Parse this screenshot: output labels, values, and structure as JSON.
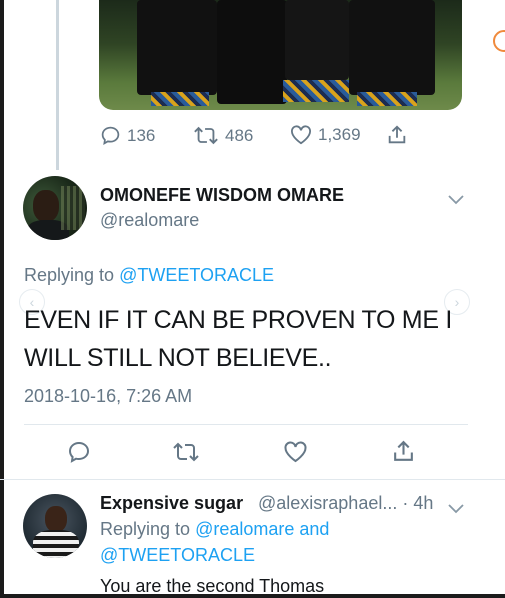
{
  "top_tweet": {
    "metrics": {
      "replies": "136",
      "retweets": "486",
      "likes": "1,369"
    }
  },
  "main_tweet": {
    "display_name": "OMONEFE WISDOM OMARE",
    "handle": "@realomare",
    "replying_prefix": "Replying to ",
    "replying_to": "@TWEETORACLE",
    "text": "EVEN IF IT CAN BE PROVEN TO ME I WILL STILL NOT BELIEVE..",
    "timestamp": "2018-10-16, 7:26 AM"
  },
  "reply": {
    "display_name": "Expensive sugar",
    "handle_time": "@alexisraphael... · 4h",
    "replying_prefix": "Replying to ",
    "replying_to_1": "@realomare",
    "replying_and": " and",
    "replying_to_2": "@TWEETORACLE",
    "text": "You are the second Thomas"
  },
  "icons": [
    "reply-icon",
    "retweet-icon",
    "like-icon",
    "share-icon",
    "chevron-down-icon"
  ],
  "colors": {
    "link": "#1da1f2",
    "secondary_text": "#657786",
    "primary_text": "#14171a",
    "thread_line": "#ccd6dd"
  }
}
